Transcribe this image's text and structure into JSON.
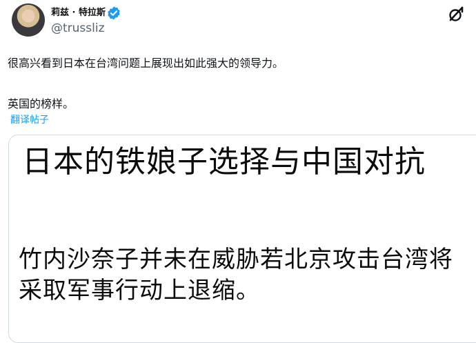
{
  "tweet": {
    "display_name": "莉兹 · 特拉斯",
    "handle": "@trussliz",
    "text_line1": "很高兴看到日本在台湾问题上展现出如此强大的领导力。",
    "text_line2": "英国的榜样。",
    "translate_link": "翻译帖子"
  },
  "card": {
    "headline": "日本的铁娘子选择与中国对抗",
    "subheadline": "竹内沙奈子并未在威胁若北京攻击台湾将采取军事行动上退缩。"
  },
  "icons": {
    "verified": "verified-badge-icon",
    "grok": "grok-icon"
  },
  "colors": {
    "link": "#1d9bf0",
    "verified": "#1d9bf0",
    "handle": "#536471",
    "border": "#cfd9de"
  }
}
